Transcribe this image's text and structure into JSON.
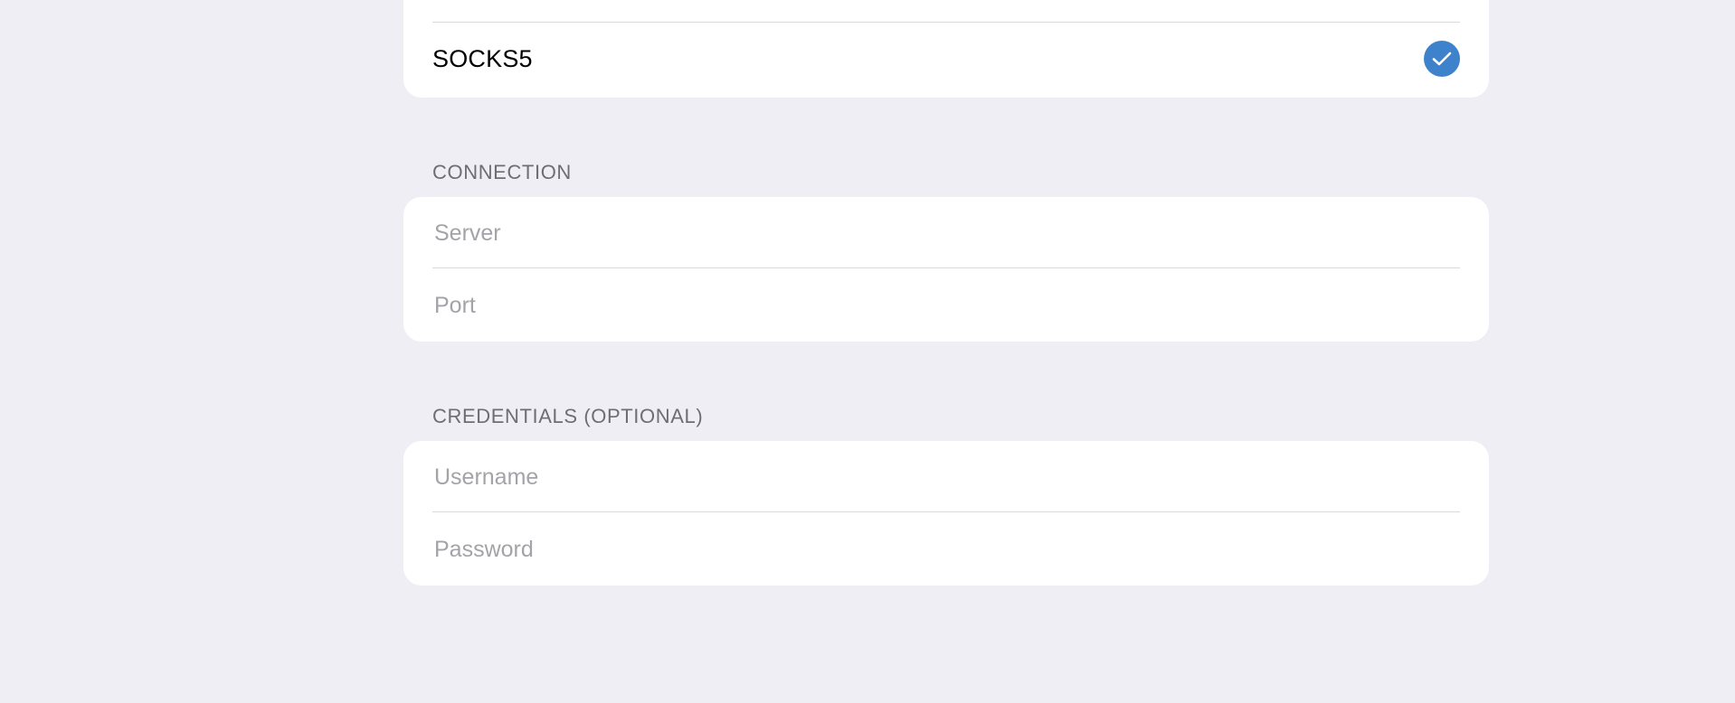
{
  "proxy_types": {
    "selected_label": "SOCKS5",
    "check_icon": "checkmark-circle-icon",
    "accent_color": "#3f82cc"
  },
  "connection": {
    "header": "CONNECTION",
    "server_placeholder": "Server",
    "port_placeholder": "Port"
  },
  "credentials": {
    "header": "CREDENTIALS (OPTIONAL)",
    "username_placeholder": "Username",
    "password_placeholder": "Password"
  }
}
